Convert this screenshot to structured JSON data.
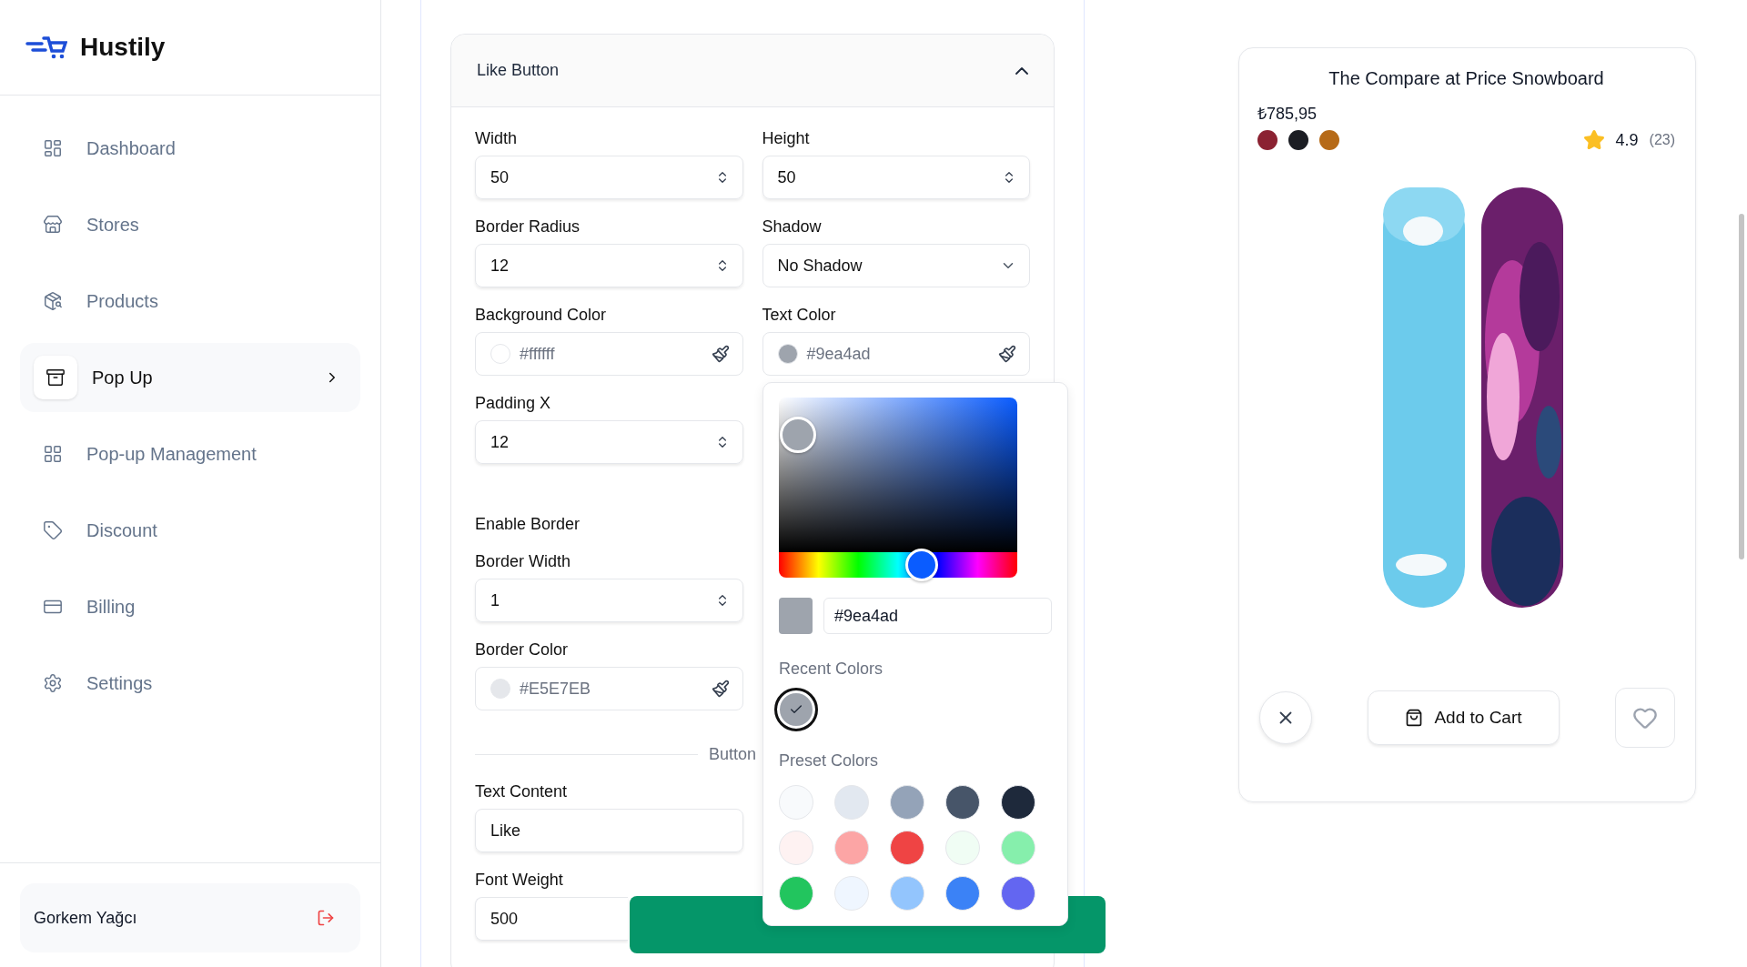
{
  "brand": {
    "name": "Hustily"
  },
  "sidebar": {
    "items": [
      {
        "label": "Dashboard",
        "selected": false
      },
      {
        "label": "Stores",
        "selected": false
      },
      {
        "label": "Products",
        "selected": false
      },
      {
        "label": "Pop Up",
        "selected": true
      },
      {
        "label": "Pop-up Management",
        "selected": false
      },
      {
        "label": "Discount",
        "selected": false
      },
      {
        "label": "Billing",
        "selected": false
      },
      {
        "label": "Settings",
        "selected": false
      }
    ],
    "user": {
      "name": "Gorkem Yağcı"
    }
  },
  "section": {
    "title": "Like Button",
    "expanded": true,
    "rows": [
      [
        {
          "kind": "number",
          "label": "Width",
          "value": "50"
        },
        {
          "kind": "number",
          "label": "Height",
          "value": "50"
        }
      ],
      [
        {
          "kind": "number",
          "label": "Border Radius",
          "value": "12"
        },
        {
          "kind": "select",
          "label": "Shadow",
          "value": "No Shadow"
        }
      ],
      [
        {
          "kind": "color",
          "label": "Background Color",
          "value": "#ffffff",
          "color": "#ffffff"
        },
        {
          "kind": "color",
          "label": "Text Color",
          "value": "#9ea4ad",
          "color": "#9ea4ad"
        }
      ],
      [
        {
          "kind": "number",
          "label": "Padding X",
          "value": "12"
        }
      ],
      [
        {
          "kind": "label",
          "label": "Enable Border"
        }
      ],
      [
        {
          "kind": "number",
          "label": "Border Width",
          "value": "1"
        }
      ],
      [
        {
          "kind": "color",
          "label": "Border Color",
          "value": "#E5E7EB",
          "color": "#e5e7eb"
        }
      ],
      [
        {
          "kind": "divider",
          "label": "Button"
        }
      ],
      [
        {
          "kind": "text",
          "label": "Text Content",
          "value": "Like"
        }
      ],
      [
        {
          "kind": "text",
          "label": "Font Weight",
          "value": "500"
        }
      ]
    ]
  },
  "color_picker": {
    "saturation": {
      "level": 0.08
    },
    "hue": {
      "level": 0.6
    },
    "hex": "#9ea4ad",
    "recent_title": "Recent Colors",
    "recent": [
      {
        "color": "#9ea4ad",
        "selected": true
      }
    ],
    "preset_title": "Preset Colors",
    "presets": [
      {
        "color": "#f8fafc"
      },
      {
        "color": "#e2e8f0"
      },
      {
        "color": "#94a3b8"
      },
      {
        "color": "#475569"
      },
      {
        "color": "#1e293b"
      },
      {
        "color": "#fef2f2"
      },
      {
        "color": "#fca5a5"
      },
      {
        "color": "#ef4444"
      },
      {
        "color": "#f0fdf4"
      },
      {
        "color": "#86efac"
      },
      {
        "color": "#22c55e"
      },
      {
        "color": "#eff6ff"
      },
      {
        "color": "#93c5fd"
      },
      {
        "color": "#3b82f6"
      },
      {
        "color": "#6366f1"
      }
    ]
  },
  "product": {
    "title": "The Compare at Price Snowboard",
    "price": "₺785,95",
    "colors": [
      {
        "color": "#8b2232"
      },
      {
        "color": "#1b1d23"
      },
      {
        "color": "#b66a17"
      }
    ],
    "rating": "4.9",
    "reviews": "(23)",
    "add_to_cart": "Add to Cart"
  }
}
